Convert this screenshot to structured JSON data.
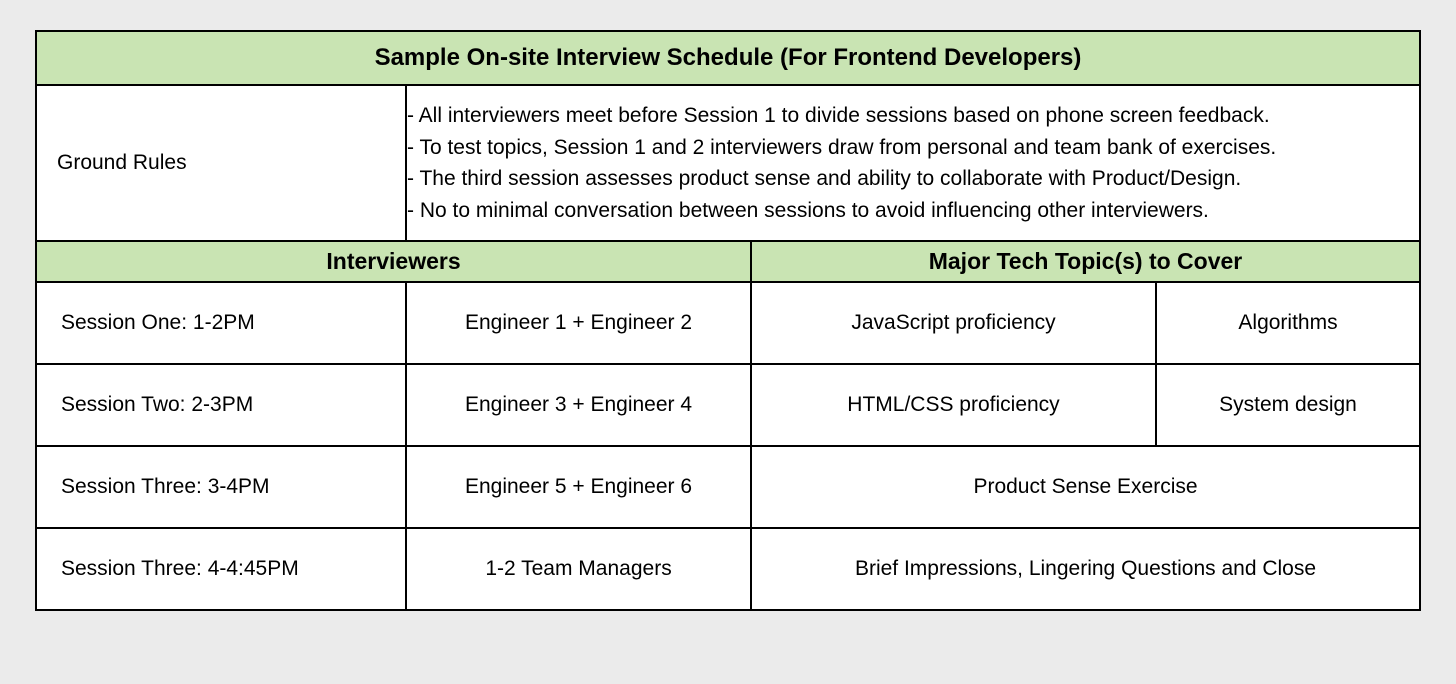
{
  "title": "Sample On-site Interview Schedule (For Frontend Developers)",
  "ground_rules": {
    "label": "Ground Rules",
    "rule1": "- All interviewers meet before Session 1 to divide sessions based on phone screen feedback.",
    "rule2": "- To test topics, Session 1 and 2 interviewers draw from personal and team bank of exercises.",
    "rule3": "- The third session assesses product sense and ability to collaborate with Product/Design.",
    "rule4": "- No to minimal conversation between sessions to avoid influencing other interviewers."
  },
  "headers": {
    "interviewers": "Interviewers",
    "topics": "Major Tech Topic(s) to Cover"
  },
  "sessions": [
    {
      "label": "Session One: 1-2PM",
      "interviewers": "Engineer 1 + Engineer 2",
      "topic1": "JavaScript proficiency",
      "topic2": "Algorithms"
    },
    {
      "label": "Session Two: 2-3PM",
      "interviewers": "Engineer 3 + Engineer 4",
      "topic1": "HTML/CSS proficiency",
      "topic2": "System design"
    },
    {
      "label": "Session Three: 3-4PM",
      "interviewers": "Engineer 5 + Engineer 6",
      "topic_merged": "Product Sense Exercise"
    },
    {
      "label": "Session Three: 4-4:45PM",
      "interviewers": "1-2 Team Managers",
      "topic_merged": "Brief Impressions, Lingering Questions and Close"
    }
  ]
}
